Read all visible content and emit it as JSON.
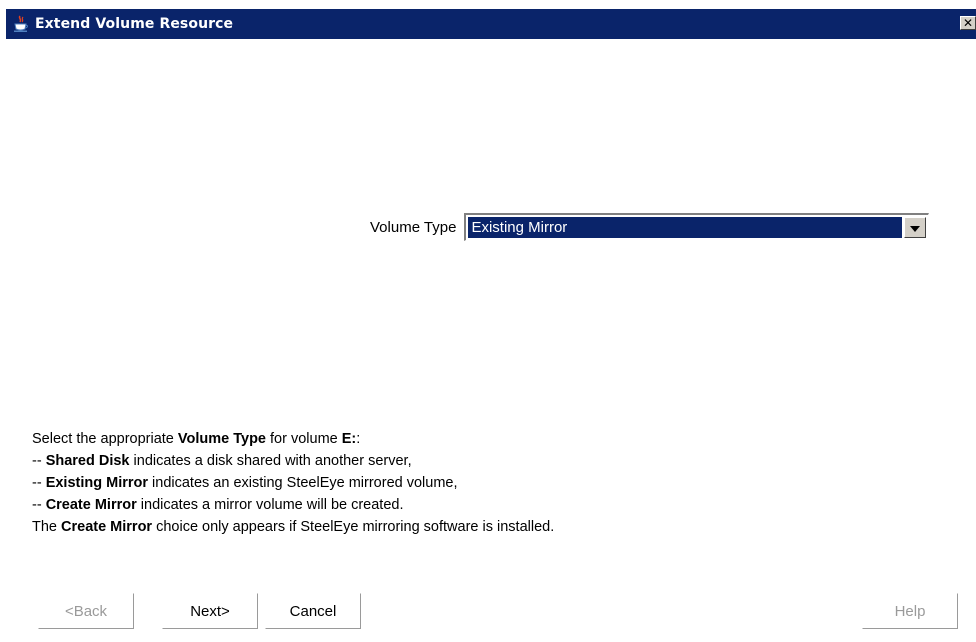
{
  "window": {
    "title": "Extend Volume Resource",
    "close_label": "✕"
  },
  "volume_type": {
    "label": "Volume Type",
    "selected": "Existing Mirror"
  },
  "description": {
    "line1_pre": "Select the appropriate ",
    "line1_bold": "Volume Type",
    "line1_mid": " for volume ",
    "line1_bold2": "E:",
    "line1_post": ":",
    "line2_pre": "-- ",
    "line2_bold": "Shared Disk",
    "line2_post": " indicates a disk shared with another server,",
    "line3_pre": "-- ",
    "line3_bold": "Existing Mirror",
    "line3_post": " indicates an existing SteelEye mirrored volume,",
    "line4_pre": "-- ",
    "line4_bold": "Create Mirror",
    "line4_post": " indicates a mirror volume will be created.",
    "line5_pre": "The ",
    "line5_bold": "Create Mirror",
    "line5_post": " choice only appears if SteelEye mirroring software is installed."
  },
  "buttons": {
    "back": "<Back",
    "next": "Next>",
    "cancel": "Cancel",
    "help": "Help"
  },
  "icons": {
    "title": "java-cup-icon",
    "close": "close-icon",
    "dropdown": "chevron-down-icon"
  },
  "colors": {
    "titlebar": "#0a246a",
    "selection": "#0a246a",
    "disabled_text": "#9a9a9a"
  }
}
